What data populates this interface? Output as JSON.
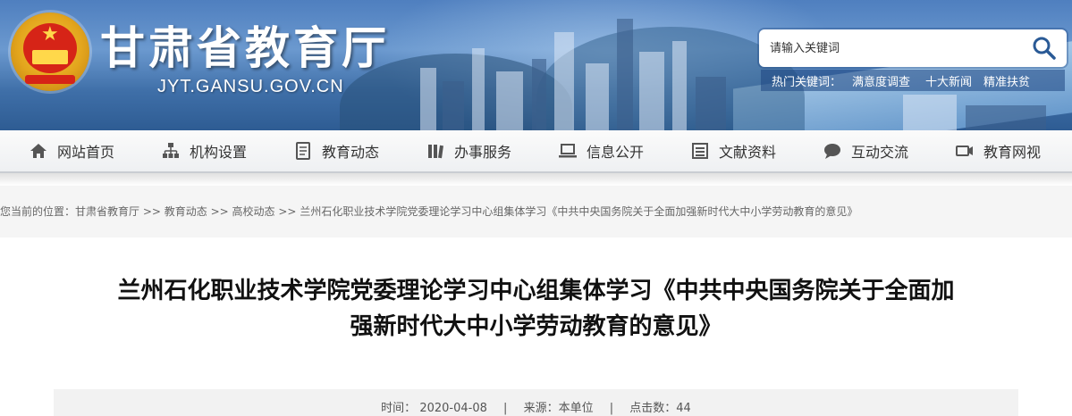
{
  "header": {
    "site_title": "甘肃省教育厅",
    "site_url": "JYT.GANSU.GOV.CN",
    "search": {
      "placeholder": "请输入关键词"
    },
    "hot_keywords": {
      "label": "热门关键词：",
      "items": [
        "满意度调查",
        "十大新闻",
        "精准扶贫"
      ]
    }
  },
  "nav": {
    "items": [
      {
        "label": "网站首页",
        "icon": "home-icon"
      },
      {
        "label": "机构设置",
        "icon": "org-chart-icon"
      },
      {
        "label": "教育动态",
        "icon": "document-icon"
      },
      {
        "label": "办事服务",
        "icon": "books-icon"
      },
      {
        "label": "信息公开",
        "icon": "laptop-icon"
      },
      {
        "label": "文献资料",
        "icon": "archive-icon"
      },
      {
        "label": "互动交流",
        "icon": "chat-icon"
      },
      {
        "label": "教育网视",
        "icon": "video-camera-icon"
      }
    ]
  },
  "breadcrumb": {
    "prefix": "您当前的位置：",
    "items": [
      "甘肃省教育厅",
      "教育动态",
      "高校动态",
      "兰州石化职业技术学院党委理论学习中心组集体学习《中共中央国务院关于全面加强新时代大中小学劳动教育的意见》"
    ],
    "separator": " >> "
  },
  "article": {
    "title_line1": "兰州石化职业技术学院党委理论学习中心组集体学习《中共中央国务院关于全面加",
    "title_line2": "强新时代大中小学劳动教育的意见》",
    "meta": {
      "time_label": "时间：",
      "time": "2020-04-08",
      "source_label": "来源：",
      "source": "本单位",
      "clicks_label": "点击数：",
      "clicks": "44",
      "divider": "|"
    }
  },
  "colors": {
    "header_blue": "#4f7fbf",
    "nav_bg": "#eef0f2",
    "title_text": "#111111"
  }
}
